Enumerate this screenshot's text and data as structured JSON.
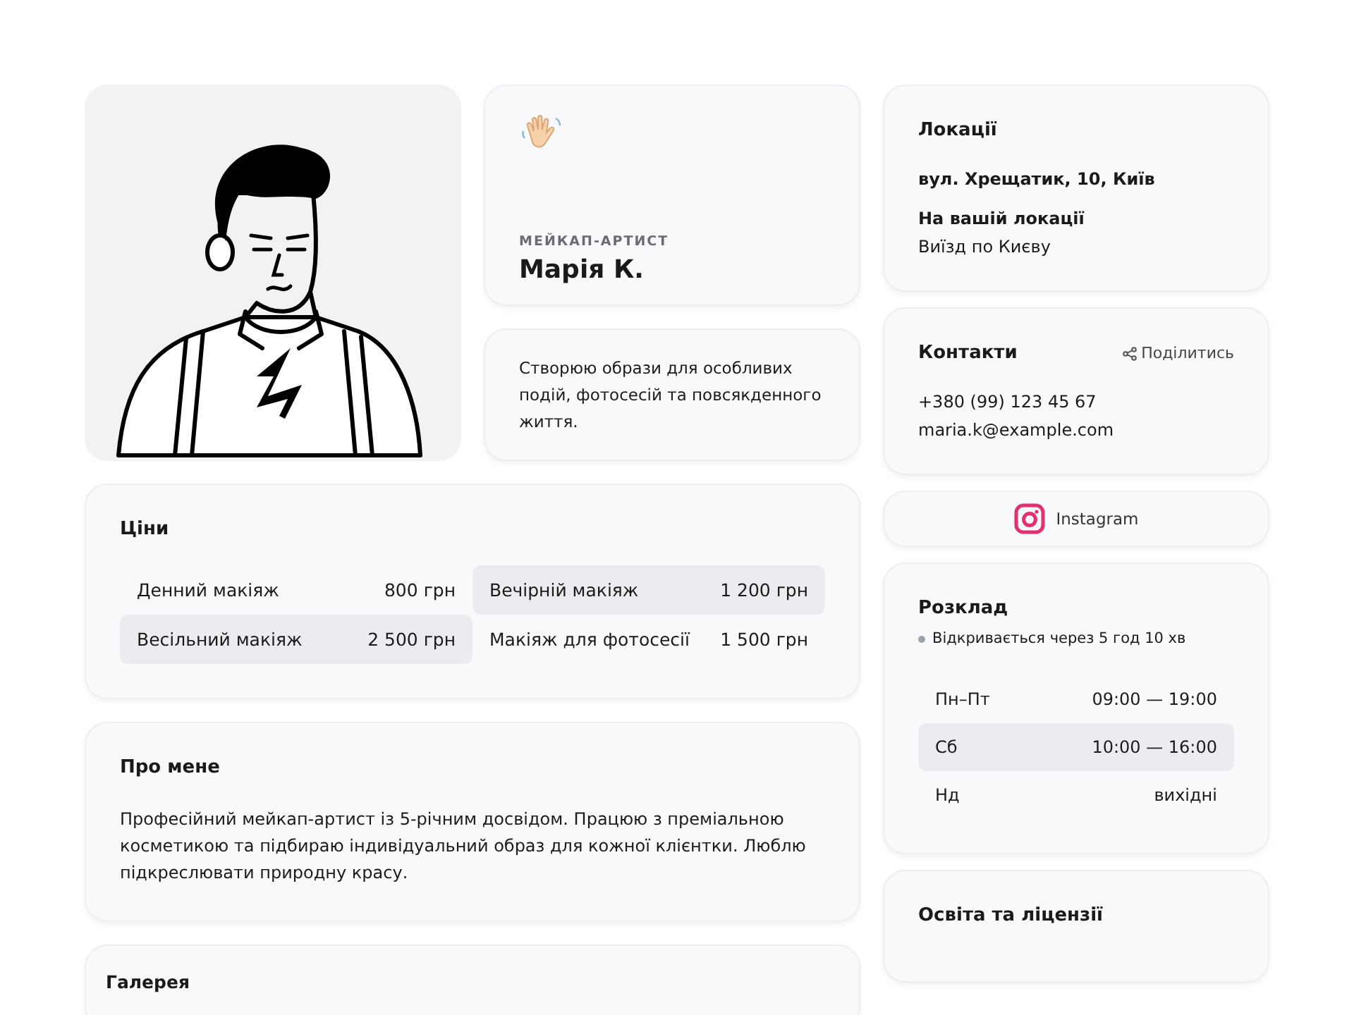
{
  "profile": {
    "role": "МЕЙКАП-АРТИСТ",
    "name": "Марія К.",
    "intro": "Створюю образи для особливих подій, фотосесій та повсякденного життя."
  },
  "prices": {
    "title": "Ціни",
    "items": [
      {
        "service": "Денний макіяж",
        "price": "800 грн",
        "highlighted": false
      },
      {
        "service": "Вечірній макіяж",
        "price": "1 200 грн",
        "highlighted": true
      },
      {
        "service": "Весільний макіяж",
        "price": "2 500 грн",
        "highlighted": true
      },
      {
        "service": "Макіяж для фотосесії",
        "price": "1 500 грн",
        "highlighted": false
      }
    ]
  },
  "about": {
    "title": "Про мене",
    "text": "Професійний мейкап-артист із 5-річним досвідом. Працюю з преміальною косметикою та підбираю індивідуальний образ для кожної клієнтки. Люблю підкреслювати природну красу."
  },
  "gallery": {
    "title": "Галерея"
  },
  "locations": {
    "title": "Локації",
    "address": "вул. Хрещатик, 10, Київ",
    "mobile_title": "На вашій локації",
    "mobile_text": "Виїзд по Києву"
  },
  "contacts": {
    "title": "Контакти",
    "share": "Поділитись",
    "phone": "+380 (99) 123 45 67",
    "email": "maria.k@example.com"
  },
  "social": {
    "label": "Instagram"
  },
  "schedule": {
    "title": "Розклад",
    "status": "Відкривається через 5 год 10 хв",
    "rows": [
      {
        "day": "Пн–Пт",
        "hours": "09:00 — 19:00",
        "highlighted": false
      },
      {
        "day": "Сб",
        "hours": "10:00 — 16:00",
        "highlighted": true
      },
      {
        "day": "Нд",
        "hours": "вихідні",
        "highlighted": false
      }
    ]
  },
  "education": {
    "title": "Освіта та ліцензії"
  }
}
